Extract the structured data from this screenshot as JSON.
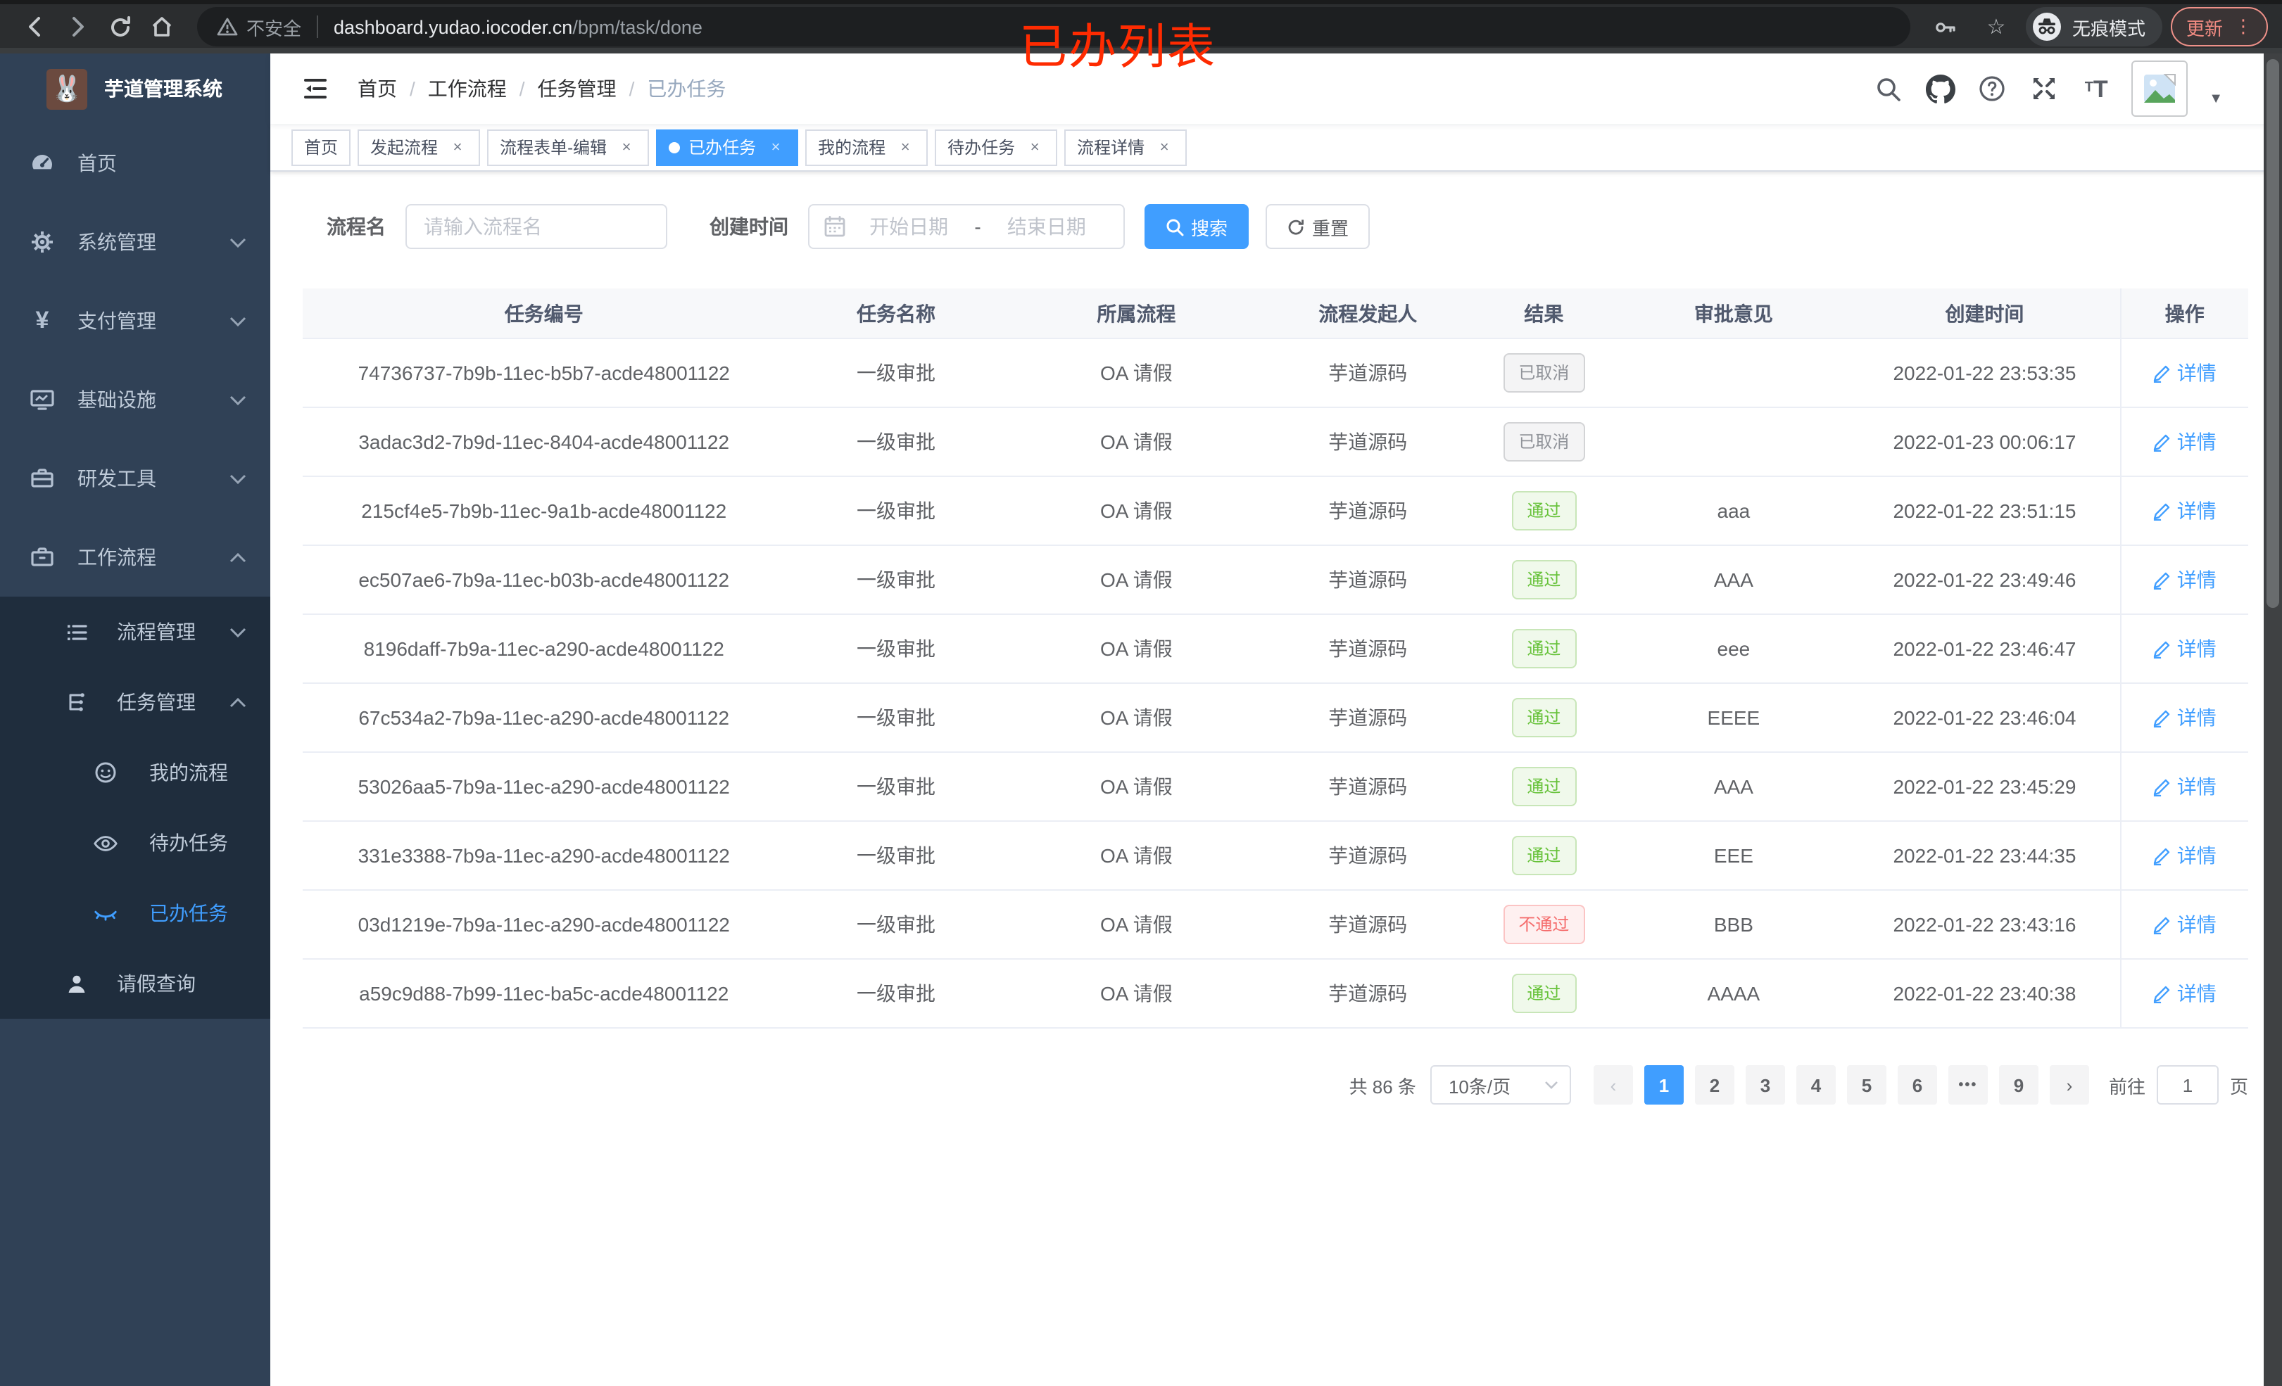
{
  "browser": {
    "security_label": "不安全",
    "url_host": "dashboard.yudao.iocoder.cn",
    "url_path": "/bpm/task/done",
    "incognito_label": "无痕模式",
    "update_label": "更新",
    "menu_dots": "⋮",
    "star": "☆"
  },
  "annotation": {
    "text": "已办列表",
    "color": "#fe2b01"
  },
  "sidebar": {
    "title": "芋道管理系统",
    "logo_icon": "rabbit-logo",
    "items": [
      {
        "label": "首页",
        "icon": "dashboard-icon"
      },
      {
        "label": "系统管理",
        "icon": "gear-icon"
      },
      {
        "label": "支付管理",
        "icon": "yen-icon"
      },
      {
        "label": "基础设施",
        "icon": "monitor-icon"
      },
      {
        "label": "研发工具",
        "icon": "toolbox-icon"
      },
      {
        "label": "工作流程",
        "icon": "briefcase-icon"
      }
    ],
    "submenu": [
      {
        "label": "流程管理",
        "icon": "list-icon"
      },
      {
        "label": "任务管理",
        "icon": "flow-icon"
      },
      {
        "label": "我的流程",
        "icon": "face-icon"
      },
      {
        "label": "待办任务",
        "icon": "eye-open-icon"
      },
      {
        "label": "已办任务",
        "icon": "eye-closed-icon",
        "active": true
      },
      {
        "label": "请假查询",
        "icon": "user-icon"
      }
    ]
  },
  "breadcrumb": {
    "items": [
      "首页",
      "工作流程",
      "任务管理",
      "已办任务"
    ],
    "separator": "/"
  },
  "tabs": [
    {
      "label": "首页",
      "closable": false,
      "active": false
    },
    {
      "label": "发起流程",
      "closable": true,
      "active": false
    },
    {
      "label": "流程表单-编辑",
      "closable": true,
      "active": false
    },
    {
      "label": "已办任务",
      "closable": true,
      "active": true
    },
    {
      "label": "我的流程",
      "closable": true,
      "active": false
    },
    {
      "label": "待办任务",
      "closable": true,
      "active": false
    },
    {
      "label": "流程详情",
      "closable": true,
      "active": false
    }
  ],
  "filters": {
    "name_label": "流程名",
    "name_placeholder": "请输入流程名",
    "time_label": "创建时间",
    "start_placeholder": "开始日期",
    "range_separator": "-",
    "end_placeholder": "结束日期",
    "search_label": "搜索",
    "reset_label": "重置"
  },
  "table": {
    "columns": [
      "任务编号",
      "任务名称",
      "所属流程",
      "流程发起人",
      "结果",
      "审批意见",
      "创建时间",
      "操作"
    ],
    "detail_label": "详情",
    "rows": [
      {
        "id": "74736737-7b9b-11ec-b5b7-acde48001122",
        "name": "一级审批",
        "process": "OA 请假",
        "starter": "芋道源码",
        "result": "已取消",
        "result_type": "info",
        "comment": "",
        "time": "2022-01-22 23:53:35"
      },
      {
        "id": "3adac3d2-7b9d-11ec-8404-acde48001122",
        "name": "一级审批",
        "process": "OA 请假",
        "starter": "芋道源码",
        "result": "已取消",
        "result_type": "info",
        "comment": "",
        "time": "2022-01-23 00:06:17"
      },
      {
        "id": "215cf4e5-7b9b-11ec-9a1b-acde48001122",
        "name": "一级审批",
        "process": "OA 请假",
        "starter": "芋道源码",
        "result": "通过",
        "result_type": "success",
        "comment": "aaa",
        "time": "2022-01-22 23:51:15"
      },
      {
        "id": "ec507ae6-7b9a-11ec-b03b-acde48001122",
        "name": "一级审批",
        "process": "OA 请假",
        "starter": "芋道源码",
        "result": "通过",
        "result_type": "success",
        "comment": "AAA",
        "time": "2022-01-22 23:49:46"
      },
      {
        "id": "8196daff-7b9a-11ec-a290-acde48001122",
        "name": "一级审批",
        "process": "OA 请假",
        "starter": "芋道源码",
        "result": "通过",
        "result_type": "success",
        "comment": "eee",
        "time": "2022-01-22 23:46:47"
      },
      {
        "id": "67c534a2-7b9a-11ec-a290-acde48001122",
        "name": "一级审批",
        "process": "OA 请假",
        "starter": "芋道源码",
        "result": "通过",
        "result_type": "success",
        "comment": "EEEE",
        "time": "2022-01-22 23:46:04"
      },
      {
        "id": "53026aa5-7b9a-11ec-a290-acde48001122",
        "name": "一级审批",
        "process": "OA 请假",
        "starter": "芋道源码",
        "result": "通过",
        "result_type": "success",
        "comment": "AAA",
        "time": "2022-01-22 23:45:29"
      },
      {
        "id": "331e3388-7b9a-11ec-a290-acde48001122",
        "name": "一级审批",
        "process": "OA 请假",
        "starter": "芋道源码",
        "result": "通过",
        "result_type": "success",
        "comment": "EEE",
        "time": "2022-01-22 23:44:35"
      },
      {
        "id": "03d1219e-7b9a-11ec-a290-acde48001122",
        "name": "一级审批",
        "process": "OA 请假",
        "starter": "芋道源码",
        "result": "不通过",
        "result_type": "danger",
        "comment": "BBB",
        "time": "2022-01-22 23:43:16"
      },
      {
        "id": "a59c9d88-7b99-11ec-ba5c-acde48001122",
        "name": "一级审批",
        "process": "OA 请假",
        "starter": "芋道源码",
        "result": "通过",
        "result_type": "success",
        "comment": "AAAA",
        "time": "2022-01-22 23:40:38"
      }
    ]
  },
  "pagination": {
    "total_text": "共 86 条",
    "page_size": "10条/页",
    "prev": "‹",
    "next": "›",
    "pages": [
      "1",
      "2",
      "3",
      "4",
      "5",
      "6",
      "•••",
      "9"
    ],
    "active_page": "1",
    "goto_label": "前往",
    "goto_value": "1",
    "page_suffix": "页"
  },
  "colors": {
    "accent": "#409eff",
    "sidebar_bg": "#304156",
    "submenu_bg": "#1f2d3d",
    "sidebar_text": "#bfcbd9",
    "success": "#67c23a",
    "danger": "#f56c6c",
    "info": "#909399",
    "annotation": "#fe2b01"
  }
}
